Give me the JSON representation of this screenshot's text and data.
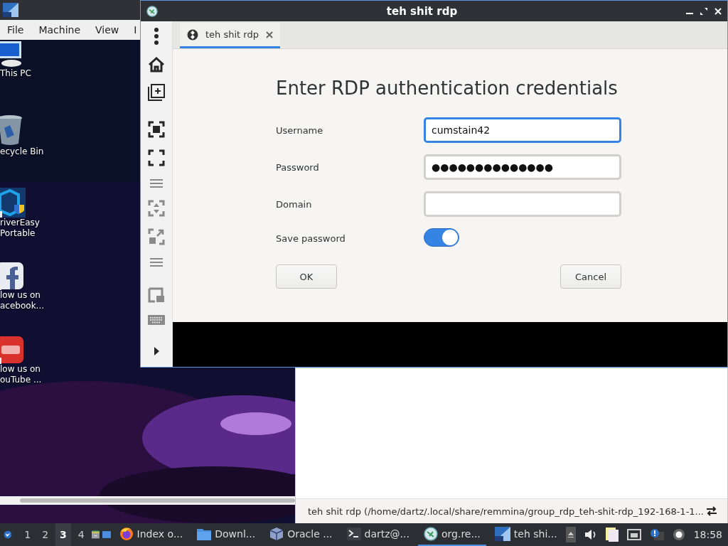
{
  "vm_window": {
    "menu": [
      "File",
      "Machine",
      "View",
      "I"
    ],
    "desktop_icons": [
      {
        "kind": "computer",
        "lines": [
          "This PC"
        ]
      },
      {
        "kind": "recycle",
        "lines": [
          "ecycle Bin"
        ]
      },
      {
        "kind": "shield",
        "lines": [
          "riverEasy",
          "Portable"
        ]
      },
      {
        "kind": "social",
        "lines": [
          "low us on",
          "acebook..."
        ]
      },
      {
        "kind": "video",
        "lines": [
          "low us on",
          "ouTube ..."
        ]
      }
    ]
  },
  "rdp_window": {
    "title": "teh shit rdp",
    "toolbar": [
      {
        "kind": "dots",
        "disabled": false
      },
      {
        "kind": "home",
        "disabled": false
      },
      {
        "kind": "add",
        "disabled": false
      },
      {
        "kind": "sep"
      },
      {
        "kind": "fit",
        "disabled": false
      },
      {
        "kind": "fullscreen",
        "disabled": false
      },
      {
        "kind": "lines",
        "disabled": true
      },
      {
        "kind": "scale",
        "disabled": true
      },
      {
        "kind": "resize",
        "disabled": true
      },
      {
        "kind": "lines",
        "disabled": true
      },
      {
        "kind": "sep"
      },
      {
        "kind": "window",
        "disabled": true
      },
      {
        "kind": "keyboard",
        "disabled": true
      },
      {
        "kind": "more",
        "disabled": false
      }
    ],
    "tab": {
      "label": "teh shit rdp",
      "selected": true
    },
    "dialog": {
      "heading": "Enter RDP authentication credentials",
      "fields": [
        {
          "label": "Username",
          "value": "cumstain42",
          "focused": true
        },
        {
          "label": "Password",
          "value": "●●●●●●●●●●●●●●",
          "focused": false
        },
        {
          "label": "Domain",
          "focused": false
        }
      ],
      "save_password": {
        "label": "Save password",
        "on": true
      },
      "buttons": [
        "OK",
        "Cancel"
      ]
    }
  },
  "main_window": {
    "status": "teh shit rdp (/home/dartz/.local/share/remmina/group_rdp_teh-shit-rdp_192-168-1-1..."
  },
  "taskbar": {
    "workspaces": [
      {
        "label": "1",
        "selected": false
      },
      {
        "label": "2",
        "selected": false
      },
      {
        "label": "3",
        "selected": true
      },
      {
        "label": "4",
        "selected": false
      }
    ],
    "tasks": [
      {
        "kind": "firefox",
        "label": "Index o...",
        "selected": false
      },
      {
        "kind": "folder",
        "label": "Downl...",
        "selected": false
      },
      {
        "kind": "vbox",
        "label": "Oracle ...",
        "selected": false
      },
      {
        "kind": "terminal",
        "label": "dartz@...",
        "selected": false
      },
      {
        "kind": "remmina",
        "label": "org.re...",
        "selected": true
      },
      {
        "kind": "vm",
        "label": "teh shi...",
        "selected": false
      }
    ],
    "clock": "18:58"
  }
}
